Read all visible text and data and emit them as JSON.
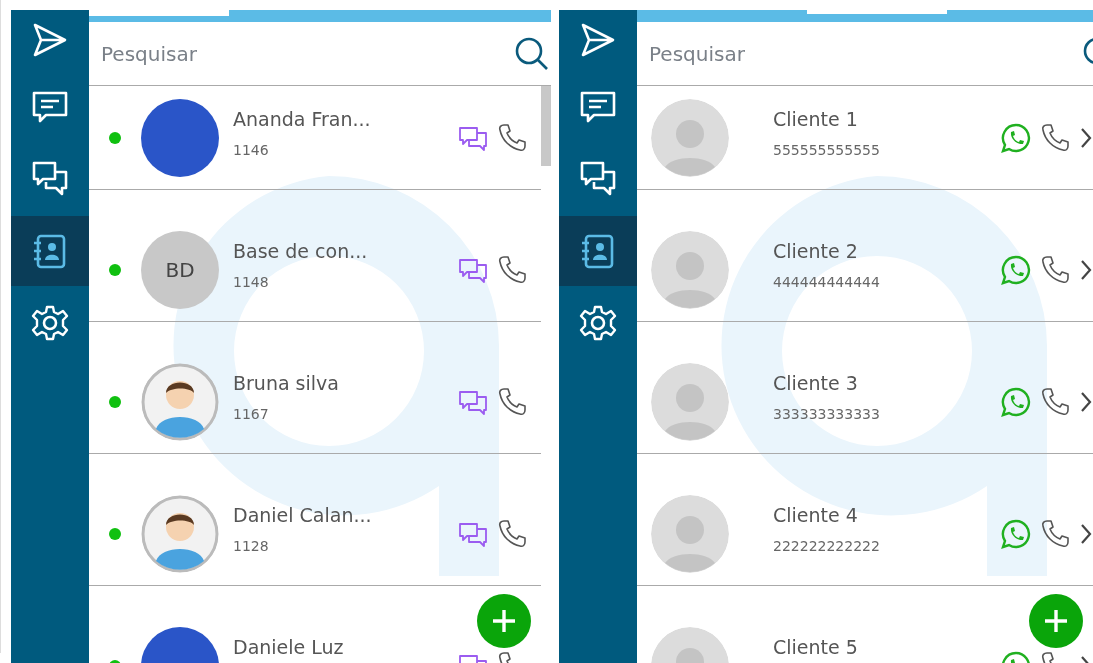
{
  "panels": [
    {
      "kind": "agents",
      "nav": [
        {
          "kind": "send",
          "selected": false
        },
        {
          "kind": "message",
          "selected": false
        },
        {
          "kind": "chats",
          "selected": false
        },
        {
          "kind": "contacts",
          "selected": true
        },
        {
          "kind": "settings",
          "selected": false
        }
      ],
      "search": {
        "placeholder": "Pesquisar"
      },
      "contacts": [
        {
          "name": "Ananda Fran...",
          "number": "1146",
          "online": true,
          "avatar": {
            "kind": "photo"
          }
        },
        {
          "name": "Base de con...",
          "number": "1148",
          "online": true,
          "avatar": {
            "kind": "initials",
            "text": "BD"
          }
        },
        {
          "name": "Bruna silva",
          "number": "1167",
          "online": true,
          "avatar": {
            "kind": "illustration"
          }
        },
        {
          "name": "Daniel Calan...",
          "number": "1128",
          "online": true,
          "avatar": {
            "kind": "illustration"
          }
        },
        {
          "name": "Daniele Luz",
          "online": true,
          "avatar": {
            "kind": "photo"
          }
        }
      ]
    },
    {
      "kind": "clients",
      "nav": [
        {
          "kind": "send",
          "selected": false
        },
        {
          "kind": "message",
          "selected": false
        },
        {
          "kind": "chats",
          "selected": false
        },
        {
          "kind": "contacts",
          "selected": true
        },
        {
          "kind": "settings",
          "selected": false
        }
      ],
      "search": {
        "placeholder": "Pesquisar"
      },
      "contacts": [
        {
          "name": "Cliente 1",
          "number": "555555555555",
          "avatar": {
            "kind": "default"
          }
        },
        {
          "name": "Cliente 2",
          "number": "444444444444",
          "avatar": {
            "kind": "default"
          }
        },
        {
          "name": "Cliente 3",
          "number": "333333333333",
          "avatar": {
            "kind": "default"
          }
        },
        {
          "name": "Cliente 4",
          "number": "222222222222",
          "avatar": {
            "kind": "default"
          }
        },
        {
          "name": "Cliente 5",
          "avatar": {
            "kind": "default"
          }
        }
      ]
    }
  ]
}
